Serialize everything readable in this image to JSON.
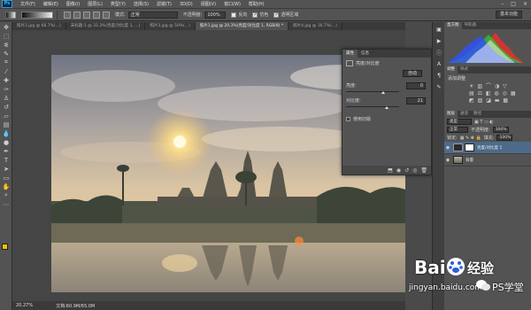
{
  "app": {
    "logo": "Ps"
  },
  "menubar": {
    "items": [
      "文件(F)",
      "编辑(E)",
      "图像(I)",
      "图层(L)",
      "类型(Y)",
      "选择(S)",
      "滤镜(T)",
      "3D(D)",
      "视图(V)",
      "窗口(W)",
      "帮助(H)"
    ],
    "window_controls": [
      "–",
      "□",
      "×"
    ]
  },
  "options": {
    "mode_label": "模式:",
    "mode_value": "正常",
    "opacity_label": "不透明度:",
    "opacity_value": "100%",
    "reverse_label": "反向",
    "dither_label": "仿色",
    "transparency_label": "透明区域",
    "workspace_label": "基本功能"
  },
  "tabs": [
    {
      "label": "照片2.jpg @ 66.7%(...)"
    },
    {
      "label": "未标题-1 @ 33.3%(亮度/对比度 1, ...)"
    },
    {
      "label": "照片3.jpg @ 50%(...)"
    },
    {
      "label": "照片1.jpg @ 20.3%(亮度/对比度 1, RGB/8) *",
      "active": true
    },
    {
      "label": "照片4.jpg @ 16.7%(...)"
    }
  ],
  "status": {
    "zoom": "20.27%",
    "doc": "文档:60.9M/65.0M"
  },
  "properties": {
    "tab_properties": "属性",
    "tab_info": "信息",
    "header": "亮度/对比度",
    "auto_label": "自动",
    "brightness_label": "亮度:",
    "brightness_value": "0",
    "contrast_label": "对比度:",
    "contrast_value": "21",
    "legacy_label": "使用旧版"
  },
  "right": {
    "histogram_tab": "直方图",
    "navigator_tab": "导航器",
    "adjust_tab_1": "调整",
    "adjust_tab_2": "样式",
    "adjust_title": "添加调整",
    "layers_tab": "图层",
    "channels_tab": "通道",
    "paths_tab": "路径",
    "kind_label": "类型",
    "blend_mode": "正常",
    "opacity_label": "不透明度:",
    "opacity_value": "100%",
    "lock_label": "锁定:",
    "fill_label": "填充:",
    "fill_value": "100%",
    "layers": [
      {
        "name": "亮度/对比度 1",
        "active": true
      },
      {
        "name": "背景",
        "active": false
      }
    ]
  },
  "watermark": {
    "baidu": "Bai",
    "jingyan": "经验",
    "url": "jingyan.baidu.com",
    "account": "PS学堂"
  },
  "colors": {
    "foreground": "#f2c200",
    "background": "#ffffff"
  }
}
